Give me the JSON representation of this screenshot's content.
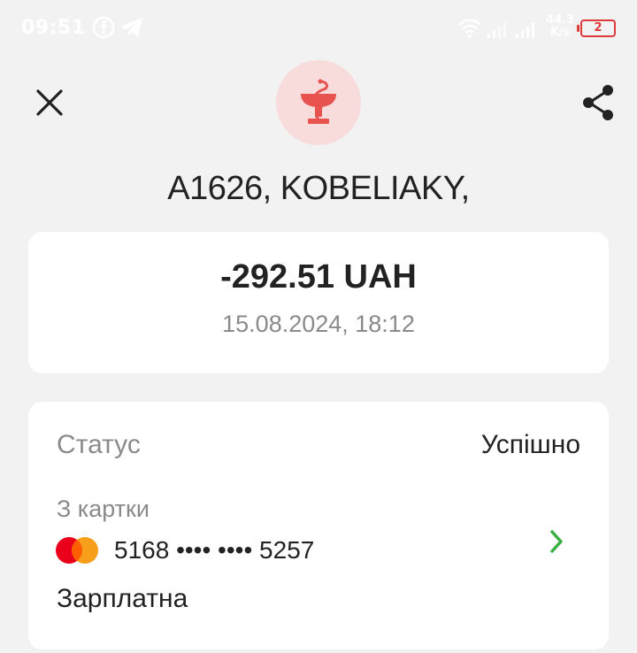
{
  "status_bar": {
    "time": "09:51",
    "network_speed": "44.3",
    "network_unit": "K/s",
    "battery_level": "2",
    "icons": [
      "facebook-icon",
      "telegram-icon",
      "wifi-icon",
      "signal-icon",
      "signal-icon",
      "battery-icon"
    ]
  },
  "header": {
    "merchant_name": "A1626, KOBELIAKY,",
    "merchant_icon": "pharmacy-icon",
    "close_icon": "close-icon",
    "share_icon": "share-icon"
  },
  "amount_card": {
    "amount": "-292.51 UAH",
    "datetime": "15.08.2024, 18:12"
  },
  "details": {
    "status_label": "Статус",
    "status_value": "Успішно",
    "from_card_label": "З картки",
    "card_number": "5168 •••• •••• 5257",
    "card_brand": "mastercard",
    "card_name": "Зарплатна"
  },
  "colors": {
    "background": "#f2f2f2",
    "card": "#ffffff",
    "accent_red": "#e8534f",
    "logo_bg": "#f8dcdb",
    "chevron_green": "#3cb043",
    "muted_text": "#8a8a8a"
  }
}
